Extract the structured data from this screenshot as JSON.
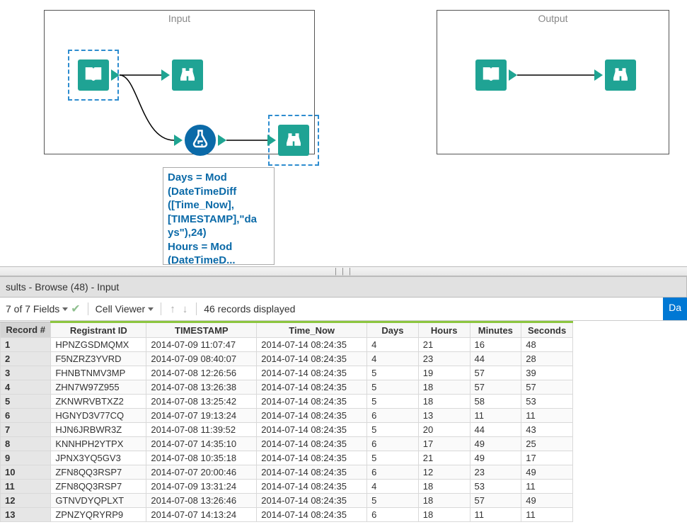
{
  "containers": {
    "input": {
      "title": "Input"
    },
    "output": {
      "title": "Output"
    }
  },
  "annotation": {
    "line1": "Days = Mod",
    "line2": "(DateTimeDiff",
    "line3": "([Time_Now],",
    "line4": "[TIMESTAMP],\"da",
    "line5": "ys\"),24)",
    "line6": "Hours = Mod",
    "line7": "(DateTimeD..."
  },
  "splitter": {
    "grip": "| | |"
  },
  "results": {
    "header": "sults - Browse (48) - Input",
    "toolbar": {
      "fields_label": "7 of 7 Fields",
      "cellviewer_label": "Cell Viewer",
      "records_label": "46 records displayed",
      "right_tab": "Da"
    },
    "columns": {
      "record": "Record #",
      "registrant": "Registrant ID",
      "timestamp": "TIMESTAMP",
      "timenow": "Time_Now",
      "days": "Days",
      "hours": "Hours",
      "minutes": "Minutes",
      "seconds": "Seconds"
    },
    "rows": [
      {
        "n": "1",
        "reg": "HPNZGSDMQMX",
        "ts": "2014-07-09 11:07:47",
        "now": "2014-07-14 08:24:35",
        "d": "4",
        "h": "21",
        "m": "16",
        "s": "48"
      },
      {
        "n": "2",
        "reg": "F5NZRZ3YVRD",
        "ts": "2014-07-09 08:40:07",
        "now": "2014-07-14 08:24:35",
        "d": "4",
        "h": "23",
        "m": "44",
        "s": "28"
      },
      {
        "n": "3",
        "reg": "FHNBTNMV3MP",
        "ts": "2014-07-08 12:26:56",
        "now": "2014-07-14 08:24:35",
        "d": "5",
        "h": "19",
        "m": "57",
        "s": "39"
      },
      {
        "n": "4",
        "reg": "ZHN7W97Z955",
        "ts": "2014-07-08 13:26:38",
        "now": "2014-07-14 08:24:35",
        "d": "5",
        "h": "18",
        "m": "57",
        "s": "57"
      },
      {
        "n": "5",
        "reg": "ZKNWRVBTXZ2",
        "ts": "2014-07-08 13:25:42",
        "now": "2014-07-14 08:24:35",
        "d": "5",
        "h": "18",
        "m": "58",
        "s": "53"
      },
      {
        "n": "6",
        "reg": "HGNYD3V77CQ",
        "ts": "2014-07-07 19:13:24",
        "now": "2014-07-14 08:24:35",
        "d": "6",
        "h": "13",
        "m": "11",
        "s": "11"
      },
      {
        "n": "7",
        "reg": "HJN6JRBWR3Z",
        "ts": "2014-07-08 11:39:52",
        "now": "2014-07-14 08:24:35",
        "d": "5",
        "h": "20",
        "m": "44",
        "s": "43"
      },
      {
        "n": "8",
        "reg": "KNNHPH2YTPX",
        "ts": "2014-07-07 14:35:10",
        "now": "2014-07-14 08:24:35",
        "d": "6",
        "h": "17",
        "m": "49",
        "s": "25"
      },
      {
        "n": "9",
        "reg": "JPNX3YQ5GV3",
        "ts": "2014-07-08 10:35:18",
        "now": "2014-07-14 08:24:35",
        "d": "5",
        "h": "21",
        "m": "49",
        "s": "17"
      },
      {
        "n": "10",
        "reg": "ZFN8QQ3RSP7",
        "ts": "2014-07-07 20:00:46",
        "now": "2014-07-14 08:24:35",
        "d": "6",
        "h": "12",
        "m": "23",
        "s": "49"
      },
      {
        "n": "11",
        "reg": "ZFN8QQ3RSP7",
        "ts": "2014-07-09 13:31:24",
        "now": "2014-07-14 08:24:35",
        "d": "4",
        "h": "18",
        "m": "53",
        "s": "11"
      },
      {
        "n": "12",
        "reg": "GTNVDYQPLXT",
        "ts": "2014-07-08 13:26:46",
        "now": "2014-07-14 08:24:35",
        "d": "5",
        "h": "18",
        "m": "57",
        "s": "49"
      },
      {
        "n": "13",
        "reg": "ZPNZYQRYRP9",
        "ts": "2014-07-07 14:13:24",
        "now": "2014-07-14 08:24:35",
        "d": "6",
        "h": "18",
        "m": "11",
        "s": "11"
      }
    ]
  }
}
